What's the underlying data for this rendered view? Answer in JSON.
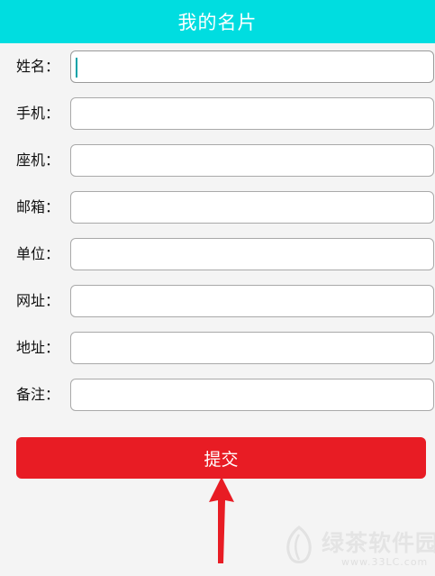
{
  "header": {
    "title": "我的名片"
  },
  "form": {
    "fields": [
      {
        "label": "姓名：",
        "value": ""
      },
      {
        "label": "手机：",
        "value": ""
      },
      {
        "label": "座机：",
        "value": ""
      },
      {
        "label": "邮箱：",
        "value": ""
      },
      {
        "label": "单位：",
        "value": ""
      },
      {
        "label": "网址：",
        "value": ""
      },
      {
        "label": "地址：",
        "value": ""
      },
      {
        "label": "备注：",
        "value": ""
      }
    ],
    "submit_label": "提交"
  },
  "watermark": {
    "text": "绿茶软件园",
    "url": "www.33LC.com"
  },
  "colors": {
    "header_bg": "#00dde0",
    "submit_bg": "#e81c24",
    "arrow": "#e81c24",
    "caret": "#00a3a8"
  },
  "icons": {
    "annotation": "arrow-up-icon",
    "watermark": "leaf-logo-icon"
  }
}
